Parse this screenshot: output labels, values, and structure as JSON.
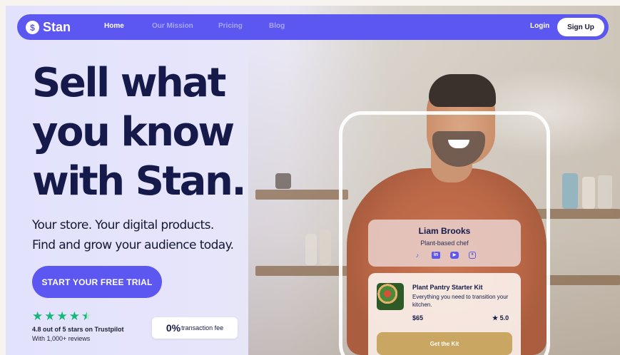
{
  "nav": {
    "logo_text": "Stan",
    "logo_glyph": "$",
    "links": [
      "Home",
      "Our Mission",
      "Pricing",
      "Blog"
    ],
    "active": "Home",
    "login_label": "Login",
    "signup_label": "Sign Up"
  },
  "hero": {
    "title_lines": [
      "Sell what",
      "you know",
      "with Stan."
    ],
    "subtitle_lines": [
      "Your store. Your digital products.",
      "Find and grow your audience today."
    ],
    "cta_label": "START YOUR FREE TRIAL"
  },
  "trust": {
    "star_rating": 4.5,
    "rating_text": "4.8 out of 5 stars on Trustpilot",
    "reviews_text": "With 1,000+ reviews",
    "fee_value": "0%",
    "fee_label": "transaction fee"
  },
  "profile": {
    "name": "Liam Brooks",
    "role": "Plant-based chef",
    "social_icons": [
      "tiktok-icon",
      "linkedin-icon",
      "youtube-icon",
      "instagram-icon"
    ]
  },
  "product": {
    "title": "Plant Pantry Starter Kit",
    "description": "Everything you need to transition your kitchen.",
    "price": "$65",
    "rating": "★ 5.0",
    "button_label": "Get the Kit"
  },
  "colors": {
    "brand": "#5d57f2",
    "headline": "#161a4a",
    "trustpilot_green": "#14b879",
    "kit_button": "#c9a661"
  }
}
